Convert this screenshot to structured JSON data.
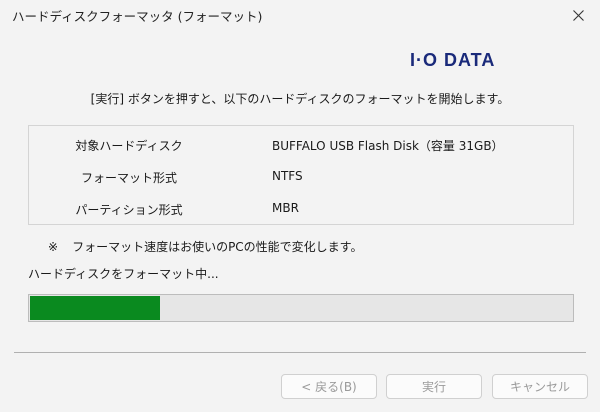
{
  "window": {
    "title": "ハードディスクフォーマッタ (フォーマット)"
  },
  "brand": {
    "logo_text": "I·O DATA",
    "logo_color": "#1a2a7a"
  },
  "instruction": "[実行] ボタンを押すと、以下のハードディスクのフォーマットを開始します。",
  "info": {
    "rows": [
      {
        "label": "対象ハードディスク",
        "value": "BUFFALO USB Flash Disk（容量 31GB）"
      },
      {
        "label": "フォーマット形式",
        "value": "NTFS"
      },
      {
        "label": "パーティション形式",
        "value": "MBR"
      }
    ]
  },
  "note": {
    "mark": "※",
    "text": "フォーマット速度はお使いのPCの性能で変化します。"
  },
  "progress": {
    "status": "ハードディスクをフォーマット中...",
    "fraction": 0.24,
    "color": "#0a8a1f"
  },
  "buttons": {
    "back": "< 戻る(B)",
    "run": "実行",
    "cancel": "キャンセル"
  },
  "icons": {
    "close": "close-icon"
  }
}
